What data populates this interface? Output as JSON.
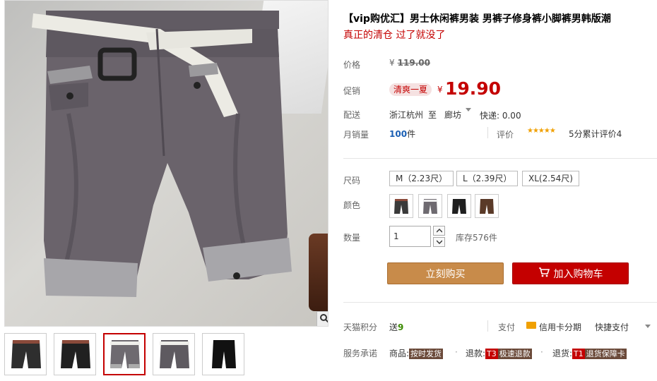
{
  "product": {
    "title": "【vip购优汇】男士休闲裤男装 男裤子修身裤小脚裤男韩版潮",
    "subtitle": "真正的清仓 过了就没了"
  },
  "price": {
    "label": "价格",
    "currency": "¥",
    "original": "119.00",
    "promo_label": "促销",
    "promo_badge": "清爽一夏",
    "current": "19.90"
  },
  "shipping": {
    "label": "配送",
    "from": "浙江杭州",
    "to_word": "至",
    "destination": "廊坊",
    "fee": "快递: 0.00"
  },
  "sales": {
    "label": "月销量",
    "count": "100",
    "unit": "件",
    "review_label": "评价",
    "stars": "★★★★★",
    "rating_text": "5分累计评价4"
  },
  "size": {
    "label": "尺码",
    "options": [
      "M（2.23尺）",
      "L（2.39尺）",
      "XL(2.54尺)"
    ]
  },
  "color": {
    "label": "颜色",
    "swatches": [
      "#3a3a3a",
      "#6e6a70",
      "#1f1f1f",
      "#5a3a28"
    ]
  },
  "quantity": {
    "label": "数量",
    "value": "1",
    "stock": "库存576件"
  },
  "actions": {
    "buy_now": "立刻购买",
    "add_to_cart": "加入购物车"
  },
  "tmall": {
    "points_label": "天猫积分",
    "points_prefix": "送",
    "points_value": "9",
    "pay_label": "支付",
    "card_installment": "信用卡分期",
    "quick_pay": "快捷支付"
  },
  "service": {
    "label": "服务承诺",
    "goods_prefix": "商品:",
    "goods_tag": "按时发货",
    "refund_prefix": "退款:",
    "refund_code": "T3",
    "refund_tag": "极速退款",
    "return_prefix": "退货:",
    "return_code": "T1",
    "return_tag": "退货保障卡"
  },
  "gallery": {
    "thumb_colors": [
      "#2e2e2e",
      "#202020",
      "#6e6a70",
      "#5e5a60",
      "#111111"
    ],
    "active_index": 2
  }
}
